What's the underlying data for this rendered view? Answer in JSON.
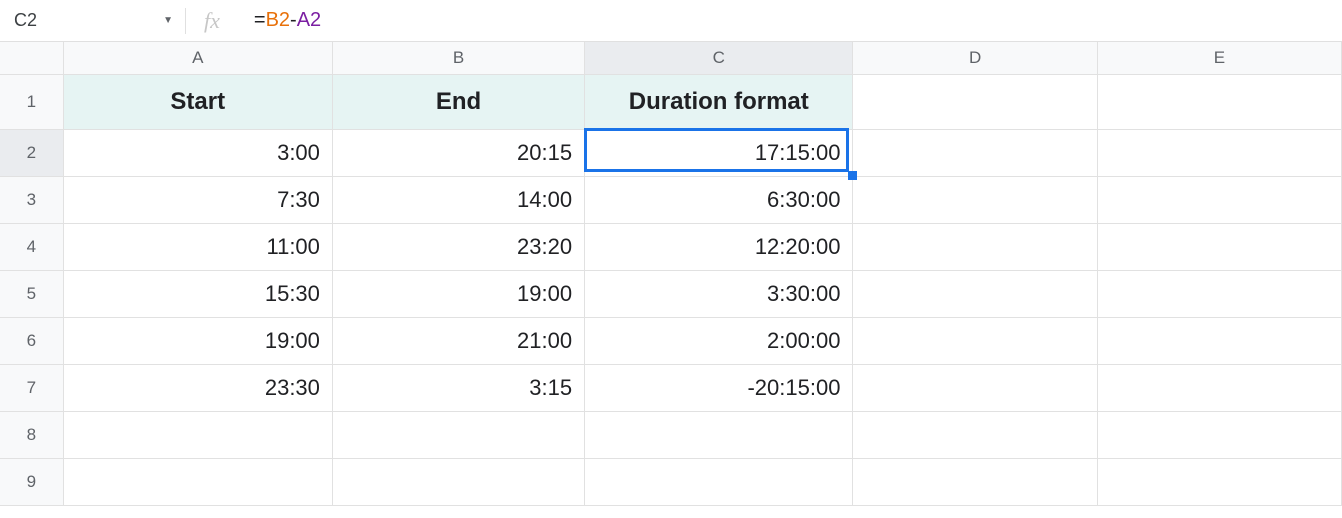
{
  "nameBox": "C2",
  "formula": {
    "eq": "=",
    "ref1": "B2",
    "op": "-",
    "ref2": "A2"
  },
  "columns": [
    "A",
    "B",
    "C",
    "D",
    "E"
  ],
  "rows": [
    "1",
    "2",
    "3",
    "4",
    "5",
    "6",
    "7",
    "8",
    "9"
  ],
  "headers": {
    "A": "Start",
    "B": "End",
    "C": "Duration format"
  },
  "data": {
    "r2": {
      "A": "3:00",
      "B": "20:15",
      "C": "17:15:00"
    },
    "r3": {
      "A": "7:30",
      "B": "14:00",
      "C": "6:30:00"
    },
    "r4": {
      "A": "11:00",
      "B": "23:20",
      "C": "12:20:00"
    },
    "r5": {
      "A": "15:30",
      "B": "19:00",
      "C": "3:30:00"
    },
    "r6": {
      "A": "19:00",
      "B": "21:00",
      "C": "2:00:00"
    },
    "r7": {
      "A": "23:30",
      "B": "3:15",
      "C": "-20:15:00"
    }
  },
  "selectedCell": "C2",
  "selectedCol": "C",
  "selectedRow": "2"
}
